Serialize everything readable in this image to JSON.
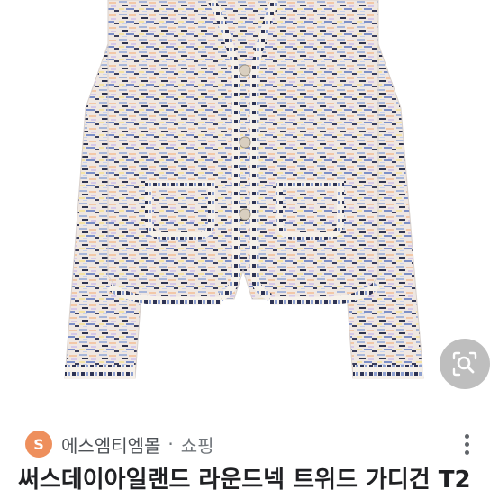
{
  "result": {
    "image_alt": "tweed cardigan",
    "lens_icon": "visual-search-icon",
    "source": {
      "favicon_letter": "S",
      "name": "에스엠티엠몰",
      "separator": "·",
      "category": "쇼핑",
      "more_icon": "more-vert-icon"
    },
    "title": "써스데이아일랜드 라운드넥 트위드 가디건 T2"
  },
  "colors": {
    "favicon_bg": "#ee8f5c",
    "source_text": "#4d5156",
    "title_text": "#202124"
  }
}
